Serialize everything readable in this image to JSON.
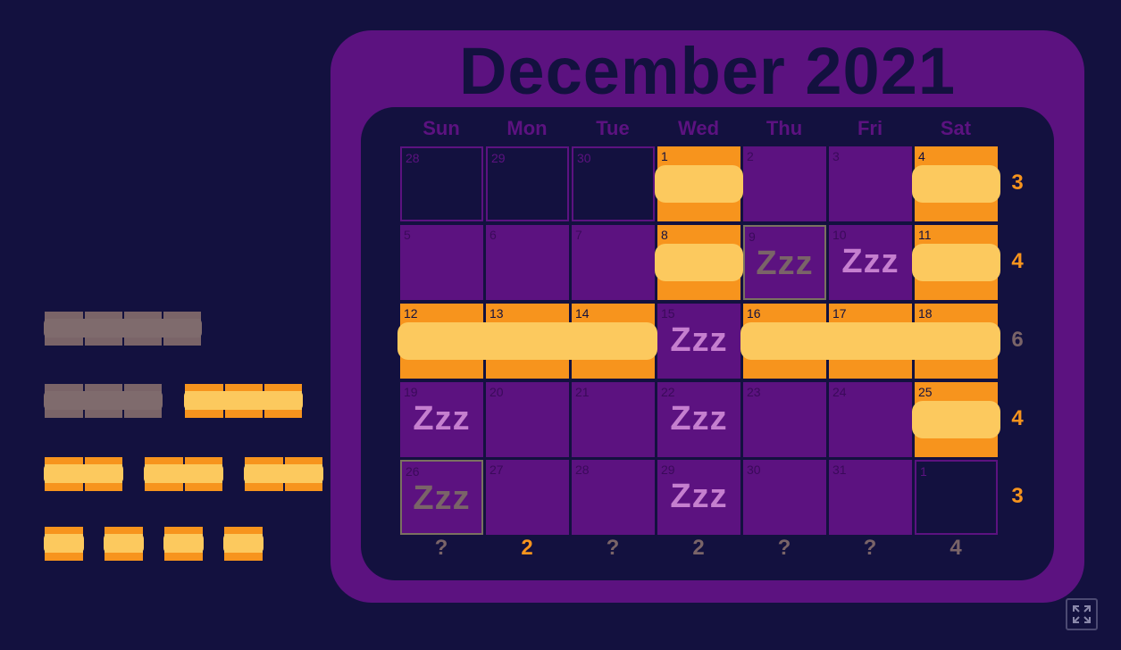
{
  "title": "December 2021",
  "weekdays": [
    "Sun",
    "Mon",
    "Tue",
    "Wed",
    "Thu",
    "Fri",
    "Sat"
  ],
  "days": [
    {
      "n": "28",
      "state": "out"
    },
    {
      "n": "29",
      "state": "out"
    },
    {
      "n": "30",
      "state": "out"
    },
    {
      "n": "1",
      "state": "filled"
    },
    {
      "n": "2",
      "state": "empty"
    },
    {
      "n": "3",
      "state": "empty"
    },
    {
      "n": "4",
      "state": "filled"
    },
    {
      "n": "5",
      "state": "empty"
    },
    {
      "n": "6",
      "state": "empty"
    },
    {
      "n": "7",
      "state": "empty"
    },
    {
      "n": "8",
      "state": "filled"
    },
    {
      "n": "9",
      "state": "zzz-marked"
    },
    {
      "n": "10",
      "state": "zzz"
    },
    {
      "n": "11",
      "state": "filled"
    },
    {
      "n": "12",
      "state": "filled"
    },
    {
      "n": "13",
      "state": "filled"
    },
    {
      "n": "14",
      "state": "filled"
    },
    {
      "n": "15",
      "state": "zzz"
    },
    {
      "n": "16",
      "state": "filled"
    },
    {
      "n": "17",
      "state": "filled"
    },
    {
      "n": "18",
      "state": "filled"
    },
    {
      "n": "19",
      "state": "zzz"
    },
    {
      "n": "20",
      "state": "empty"
    },
    {
      "n": "21",
      "state": "empty"
    },
    {
      "n": "22",
      "state": "zzz"
    },
    {
      "n": "23",
      "state": "empty"
    },
    {
      "n": "24",
      "state": "empty"
    },
    {
      "n": "25",
      "state": "filled"
    },
    {
      "n": "26",
      "state": "zzz-marked"
    },
    {
      "n": "27",
      "state": "empty"
    },
    {
      "n": "28",
      "state": "empty"
    },
    {
      "n": "29",
      "state": "zzz"
    },
    {
      "n": "30",
      "state": "empty"
    },
    {
      "n": "31",
      "state": "empty"
    },
    {
      "n": "1",
      "state": "out"
    }
  ],
  "zzz_label": "Zzz",
  "row_counts": [
    {
      "value": "3",
      "highlight": true
    },
    {
      "value": "4",
      "highlight": true
    },
    {
      "value": "6",
      "highlight": false
    },
    {
      "value": "4",
      "highlight": true
    },
    {
      "value": "3",
      "highlight": true
    }
  ],
  "col_counts": [
    {
      "value": "?",
      "highlight": false
    },
    {
      "value": "2",
      "highlight": true
    },
    {
      "value": "?",
      "highlight": false
    },
    {
      "value": "2",
      "highlight": false
    },
    {
      "value": "?",
      "highlight": false
    },
    {
      "value": "?",
      "highlight": false
    },
    {
      "value": "4",
      "highlight": false
    }
  ],
  "tray_pieces": [
    {
      "size": 4,
      "color": "gray"
    },
    {
      "size": 3,
      "color": "gray"
    },
    {
      "size": 3,
      "color": "orange"
    },
    {
      "size": 2,
      "color": "orange"
    },
    {
      "size": 2,
      "color": "orange"
    },
    {
      "size": 2,
      "color": "orange"
    },
    {
      "size": 1,
      "color": "orange"
    },
    {
      "size": 1,
      "color": "orange"
    },
    {
      "size": 1,
      "color": "orange"
    },
    {
      "size": 1,
      "color": "orange"
    }
  ],
  "placed_pieces": [
    {
      "row": 0,
      "col": 3,
      "size": 1
    },
    {
      "row": 0,
      "col": 6,
      "size": 1
    },
    {
      "row": 1,
      "col": 3,
      "size": 1
    },
    {
      "row": 1,
      "col": 6,
      "size": 1
    },
    {
      "row": 2,
      "col": 0,
      "size": 3
    },
    {
      "row": 2,
      "col": 4,
      "size": 3
    },
    {
      "row": 3,
      "col": 6,
      "size": 1
    }
  ],
  "colors": {
    "background": "#13113f",
    "board": "#5c1280",
    "piece_orange": "#f7941d",
    "piece_yellow": "#fcc95e",
    "piece_gray": "#7a6468",
    "zzz": "#c57fcf"
  },
  "icons": {
    "fullscreen": "expand-icon"
  }
}
